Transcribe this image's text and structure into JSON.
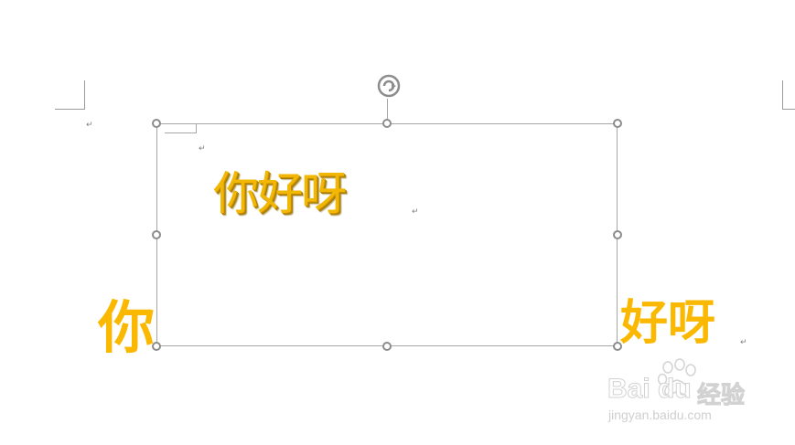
{
  "document": {
    "paragraph_mark": "↵",
    "textbox_text": "你好呀",
    "outside_left_text": "你",
    "outside_right_text": "好呀"
  },
  "watermark": {
    "brand": "Bai du",
    "brand_cn": "经验",
    "url": "jingyan.baidu.com"
  },
  "colors": {
    "text_gold": "#f2b705",
    "handle_border": "#8c8c8c",
    "frame_border": "#a6a6a6"
  }
}
